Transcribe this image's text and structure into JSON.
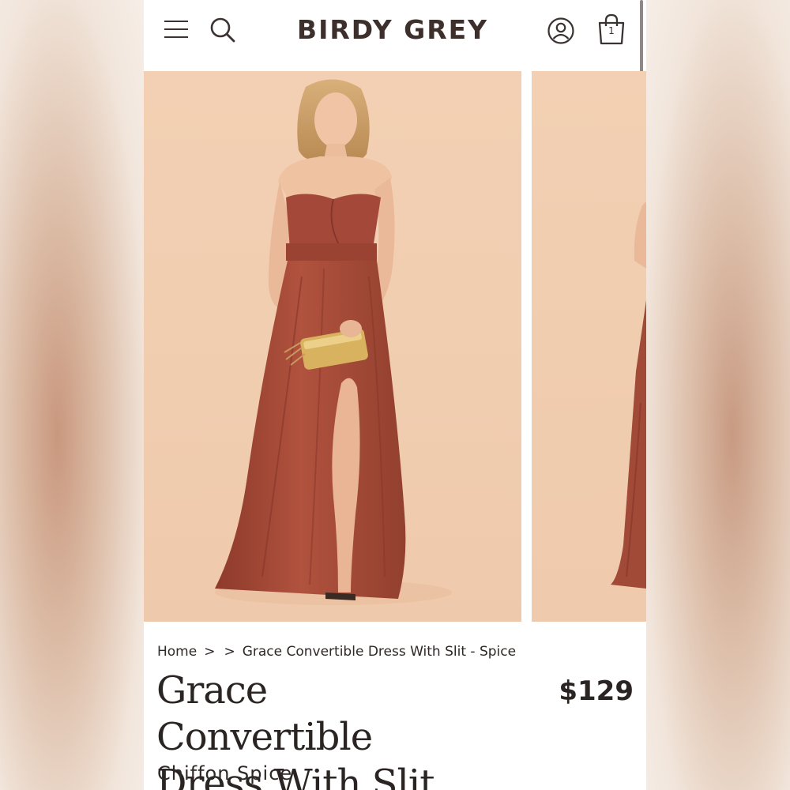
{
  "header": {
    "logo": "BIRDY GREY",
    "bag_count": "1",
    "icons": [
      "menu-icon",
      "search-icon",
      "account-icon",
      "shopping-bag-icon"
    ]
  },
  "gallery": {
    "image_count_visible": 2,
    "background_color": "#f2ceb1",
    "dress_color": "#a84a38"
  },
  "breadcrumb": {
    "home": "Home",
    "separator": ">",
    "current": "Grace Convertible Dress With Slit - Spice"
  },
  "product": {
    "title_line1": "Grace Convertible",
    "title_line2": "Dress With Slit",
    "price": "$129",
    "subtitle": "Chiffon Spice"
  },
  "colors": {
    "text_dark": "#2a2523",
    "logo": "#3c2f2c"
  }
}
